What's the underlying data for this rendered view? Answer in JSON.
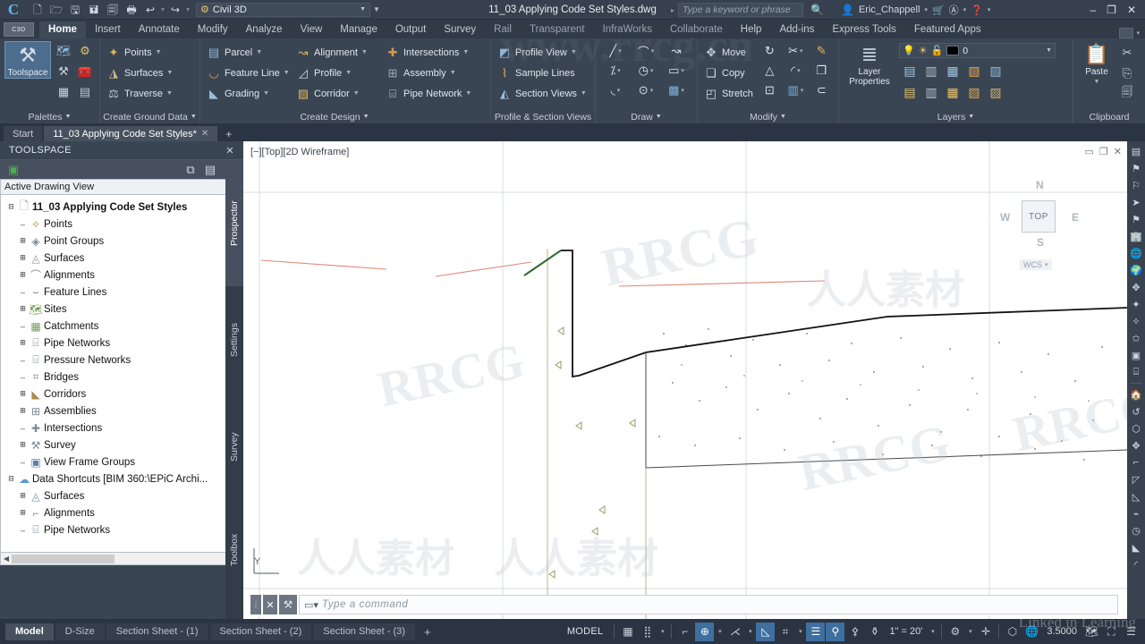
{
  "titlebar": {
    "app_logo": "C",
    "quick_access": [
      {
        "name": "new-file-icon",
        "glyph": "🗋"
      },
      {
        "name": "open-folder-icon",
        "glyph": "🗀"
      },
      {
        "name": "save-icon",
        "glyph": "🖫"
      },
      {
        "name": "save-as-icon",
        "glyph": "🖫"
      },
      {
        "name": "plot-preview-icon",
        "glyph": "🗐"
      },
      {
        "name": "print-icon",
        "glyph": "🖶"
      },
      {
        "name": "undo-icon",
        "glyph": "↩"
      },
      {
        "name": "redo-icon",
        "glyph": "↪"
      }
    ],
    "workspace": "Civil 3D",
    "document_title": "11_03 Applying Code Set Styles.dwg",
    "search_placeholder": "Type a keyword or phrase",
    "user": "Eric_Chappell",
    "window_min": "‒",
    "window_max": "❐",
    "window_close": "✕"
  },
  "ribbon_tabs": {
    "badge": "C3D",
    "items": [
      {
        "label": "Home",
        "active": true
      },
      {
        "label": "Insert",
        "active": false
      },
      {
        "label": "Annotate",
        "active": false
      },
      {
        "label": "Modify",
        "active": false
      },
      {
        "label": "Analyze",
        "active": false
      },
      {
        "label": "View",
        "active": false
      },
      {
        "label": "Manage",
        "active": false
      },
      {
        "label": "Output",
        "active": false
      },
      {
        "label": "Survey",
        "active": false
      },
      {
        "label": "Rail",
        "active": false
      },
      {
        "label": "Transparent",
        "active": false
      },
      {
        "label": "InfraWorks",
        "active": false
      },
      {
        "label": "Collaborate",
        "active": false
      },
      {
        "label": "Help",
        "active": false
      },
      {
        "label": "Add-ins",
        "active": false
      },
      {
        "label": "Express Tools",
        "active": false
      },
      {
        "label": "Featured Apps",
        "active": false
      }
    ]
  },
  "ribbon": {
    "panels": [
      {
        "title": "Palettes",
        "big_button": {
          "label": "Toolspace",
          "icon": "⚒",
          "selected": true
        },
        "icons": [
          "🗺",
          "⚙",
          "🛠",
          "🧰",
          "🧮",
          "🗒"
        ]
      },
      {
        "title": "Create Ground Data",
        "rows": [
          {
            "label": "Points",
            "icon": "✧",
            "caret": true
          },
          {
            "label": "Surfaces",
            "icon": "◮",
            "caret": true
          },
          {
            "label": "Traverse",
            "icon": "⚖",
            "caret": true
          }
        ]
      },
      {
        "title": "",
        "rows": [
          {
            "label": "Parcel",
            "icon": "▤",
            "caret": true
          },
          {
            "label": "Feature Line",
            "icon": "◡",
            "caret": true
          },
          {
            "label": "Grading",
            "icon": "◣",
            "caret": true
          }
        ]
      },
      {
        "title": "Create Design",
        "rows": [
          {
            "label": "Alignment",
            "icon": "↝",
            "caret": true
          },
          {
            "label": "Profile",
            "icon": "◿",
            "caret": true
          },
          {
            "label": "Corridor",
            "icon": "▨",
            "caret": true
          }
        ]
      },
      {
        "title": "",
        "rows": [
          {
            "label": "Intersections",
            "icon": "✚",
            "caret": true
          },
          {
            "label": "Assembly",
            "icon": "⊞",
            "caret": true
          },
          {
            "label": "Pipe Network",
            "icon": "⌸",
            "caret": true
          }
        ]
      },
      {
        "title": "Profile & Section Views",
        "rows": [
          {
            "label": "Profile View",
            "icon": "◩",
            "caret": true
          },
          {
            "label": "Sample Lines",
            "icon": "⌇",
            "caret": false
          },
          {
            "label": "Section Views",
            "icon": "◭",
            "caret": true
          }
        ]
      },
      {
        "title": "Draw",
        "grid": [
          {
            "icon": "╱",
            "caret": true
          },
          {
            "icon": "⌒",
            "caret": true
          },
          {
            "icon": "↺",
            "caret": false
          },
          {
            "icon": "⁒",
            "caret": true
          },
          {
            "icon": "◷",
            "caret": true
          },
          {
            "icon": "▭",
            "caret": true
          },
          {
            "icon": "◟",
            "caret": true
          },
          {
            "icon": "⊙",
            "caret": true
          },
          {
            "icon": "▩",
            "caret": true
          }
        ]
      },
      {
        "title": "Modify",
        "rows": [
          {
            "label": "Move",
            "icon": "✥",
            "caret": false
          },
          {
            "label": "Copy",
            "icon": "❏",
            "caret": false
          },
          {
            "label": "Stretch",
            "icon": "◰",
            "caret": false
          }
        ],
        "grid": [
          {
            "icon": "↻",
            "caret": false
          },
          {
            "icon": "✂",
            "caret": true
          },
          {
            "icon": "✎",
            "caret": false
          },
          {
            "icon": "△",
            "caret": false
          },
          {
            "icon": "◜",
            "caret": true
          },
          {
            "icon": "❐",
            "caret": false
          },
          {
            "icon": "⊡",
            "caret": false
          },
          {
            "icon": "▥",
            "caret": true
          },
          {
            "icon": "⊂",
            "caret": false
          }
        ]
      },
      {
        "title": "Layers",
        "big_button": {
          "label": "Layer\nProperties",
          "icon": "≣",
          "selected": false
        },
        "layer_value": "0",
        "layer_color": "#000000",
        "layer_state_icons": [
          "💡",
          "☀",
          "🔓"
        ],
        "icons": [
          "▤",
          "▥",
          "▦",
          "▧",
          "▨",
          "▩",
          "▤",
          "▥",
          "▦",
          "▧"
        ]
      },
      {
        "title": "Clipboard",
        "big_button": {
          "label": "Paste",
          "icon": "📋",
          "selected": false
        },
        "icons": [
          "✂",
          "⎘",
          "📄"
        ]
      }
    ]
  },
  "file_tabs": [
    {
      "label": "Start",
      "active": false,
      "closable": false
    },
    {
      "label": "11_03 Applying Code Set Styles*",
      "active": true,
      "closable": true
    }
  ],
  "file_tab_add": "+",
  "toolspace": {
    "title": "TOOLSPACE",
    "close": "✕",
    "toolbar_icons": [
      "▣",
      "⧉",
      "▤",
      "?"
    ],
    "view_selector": "Active Drawing View",
    "vertical_tabs": [
      {
        "label": "Prospector",
        "active": true
      },
      {
        "label": "Settings",
        "active": false
      },
      {
        "label": "Survey",
        "active": false
      },
      {
        "label": "Toolbox",
        "active": false
      }
    ],
    "tree": [
      {
        "label": "11_03 Applying Code Set Styles",
        "indent": 0,
        "expander": "-",
        "icon": "🗋",
        "bold": true
      },
      {
        "label": "Points",
        "indent": 1,
        "expander": "",
        "icon": "✧",
        "bold": false
      },
      {
        "label": "Point Groups",
        "indent": 1,
        "expander": "+",
        "icon": "◈",
        "bold": false
      },
      {
        "label": "Surfaces",
        "indent": 1,
        "expander": "+",
        "icon": "◬",
        "bold": false
      },
      {
        "label": "Alignments",
        "indent": 1,
        "expander": "+",
        "icon": "⌒",
        "bold": false
      },
      {
        "label": "Feature Lines",
        "indent": 1,
        "expander": "",
        "icon": "⌣",
        "bold": false
      },
      {
        "label": "Sites",
        "indent": 1,
        "expander": "+",
        "icon": "🗺",
        "bold": false
      },
      {
        "label": "Catchments",
        "indent": 1,
        "expander": "",
        "icon": "▦",
        "bold": false
      },
      {
        "label": "Pipe Networks",
        "indent": 1,
        "expander": "+",
        "icon": "⌸",
        "bold": false
      },
      {
        "label": "Pressure Networks",
        "indent": 1,
        "expander": "",
        "icon": "⌸",
        "bold": false
      },
      {
        "label": "Bridges",
        "indent": 1,
        "expander": "",
        "icon": "⌗",
        "bold": false
      },
      {
        "label": "Corridors",
        "indent": 1,
        "expander": "+",
        "icon": "◣",
        "bold": false
      },
      {
        "label": "Assemblies",
        "indent": 1,
        "expander": "+",
        "icon": "⊞",
        "bold": false
      },
      {
        "label": "Intersections",
        "indent": 1,
        "expander": "",
        "icon": "✚",
        "bold": false
      },
      {
        "label": "Survey",
        "indent": 1,
        "expander": "+",
        "icon": "⚒",
        "bold": false
      },
      {
        "label": "View Frame Groups",
        "indent": 1,
        "expander": "",
        "icon": "▣",
        "bold": false
      },
      {
        "label": "Data Shortcuts [BIM 360:\\EPiC Archi...",
        "indent": 0,
        "expander": "-",
        "icon": "☁",
        "bold": false
      },
      {
        "label": "Surfaces",
        "indent": 1,
        "expander": "+",
        "icon": "◬",
        "bold": false
      },
      {
        "label": "Alignments",
        "indent": 1,
        "expander": "+",
        "icon": "⌒",
        "bold": false
      },
      {
        "label": "Pipe Networks",
        "indent": 1,
        "expander": "",
        "icon": "⌸",
        "bold": false
      }
    ]
  },
  "drawing": {
    "viewport_label": "[−][Top][2D Wireframe]",
    "viewport_controls": [
      "▭",
      "❐",
      "✕"
    ],
    "viewcube": {
      "face": "TOP",
      "north": "N",
      "south": "S",
      "east": "E",
      "west": "W",
      "ucs": "WCS"
    },
    "ucs_axis_y": "Y",
    "command_placeholder": "Type a command",
    "right_toolbar_icons": [
      "▤",
      "⚑",
      "⚐",
      "➤",
      "⚑",
      "🏢",
      "🌐",
      "🌍",
      "✥",
      "✦",
      "✧",
      "✩",
      "▣",
      "⌸",
      "🏠",
      "↺",
      "⬡",
      "✥",
      "⌐",
      "◸",
      "◺",
      "⌁",
      "◷",
      "◣",
      "◜"
    ]
  },
  "status_bar": {
    "layout_tabs": [
      {
        "label": "Model",
        "active": true
      },
      {
        "label": "D-Size",
        "active": false
      },
      {
        "label": "Section Sheet - (1)",
        "active": false
      },
      {
        "label": "Section Sheet - (2)",
        "active": false
      },
      {
        "label": "Section Sheet - (3)",
        "active": false
      }
    ],
    "layout_add": "+",
    "model_label": "MODEL",
    "toggles": [
      {
        "name": "grid-display-toggle",
        "glyph": "▦",
        "on": false,
        "caret": false
      },
      {
        "name": "snap-mode-toggle",
        "glyph": "⣿",
        "on": false,
        "caret": true
      },
      {
        "name": "ortho-mode-toggle",
        "glyph": "⌐",
        "on": false,
        "caret": false
      },
      {
        "name": "polar-tracking-toggle",
        "glyph": "⊕",
        "on": true,
        "caret": true
      },
      {
        "name": "object-snap-tracking-toggle",
        "glyph": "⋌",
        "on": false,
        "caret": true
      },
      {
        "name": "object-snap-toggle",
        "glyph": "◺",
        "on": true,
        "caret": false
      },
      {
        "name": "3d-object-snap-toggle",
        "glyph": "⌗",
        "on": false,
        "caret": true
      },
      {
        "name": "dynamic-ucs-toggle",
        "glyph": "☰",
        "on": true,
        "caret": false
      },
      {
        "name": "transparency-toggle",
        "glyph": "👤",
        "on": true,
        "caret": false
      },
      {
        "name": "selection-cycling-toggle",
        "glyph": "👥",
        "on": false,
        "caret": false
      },
      {
        "name": "annotation-visibility-toggle",
        "glyph": "👤",
        "on": false,
        "caret": false
      }
    ],
    "annotation_scale": "1\" = 20'",
    "settings_icon": "⚙",
    "add_icon": "✛",
    "isolate_objects_icon": "⬡",
    "workspace_icon": "🌐",
    "lineweight_value": "3.5000",
    "hardware_icon": "🗺",
    "fullscreen_icon": "⛶",
    "customization_icon": "☰"
  },
  "watermarks": {
    "brand": "RRCG",
    "cn_text": "人人素材",
    "site": "www.rrcg.cn",
    "learning": "Linked in Learning"
  }
}
